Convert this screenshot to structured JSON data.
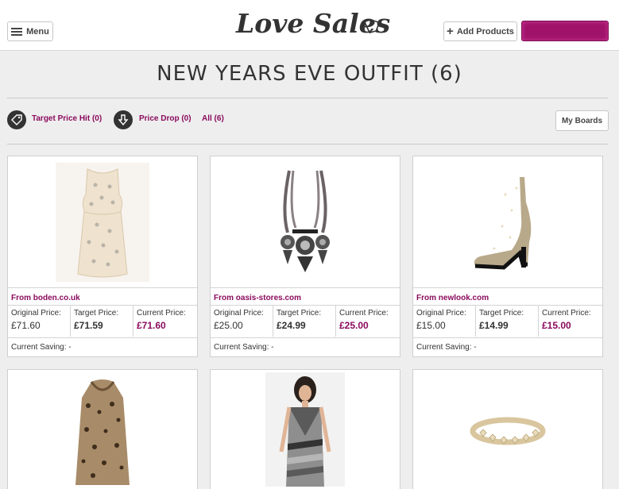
{
  "header": {
    "menu_label": "Menu",
    "logo_text": "Love Sales",
    "add_products_label": "Add Products"
  },
  "page": {
    "title": "NEW YEARS EVE OUTFIT (6)"
  },
  "filters": {
    "target_price_hit": "Target Price Hit (0)",
    "price_drop": "Price Drop (0)",
    "all": "All (6)",
    "my_boards": "My Boards"
  },
  "labels": {
    "original_price": "Original Price:",
    "target_price": "Target Price:",
    "current_price": "Current Price:",
    "current_saving": "Current Saving: -"
  },
  "products": [
    {
      "source": "From boden.co.uk",
      "original": "£71.60",
      "target": "£71.59",
      "current": "£71.60",
      "image_icon": "cream-dress-image"
    },
    {
      "source": "From oasis-stores.com",
      "original": "£25.00",
      "target": "£24.99",
      "current": "£25.00",
      "image_icon": "statement-necklace-image"
    },
    {
      "source": "From newlook.com",
      "original": "£15.00",
      "target": "£14.99",
      "current": "£15.00",
      "image_icon": "glitter-ankle-boot-image"
    },
    {
      "image_icon": "leopard-fur-coat-image"
    },
    {
      "image_icon": "bandage-dress-model-image"
    },
    {
      "image_icon": "gold-heart-bracelet-image"
    }
  ],
  "colors": {
    "accent": "#8a0b5d",
    "account_button": "#a0136b",
    "background": "#eeeeee"
  }
}
